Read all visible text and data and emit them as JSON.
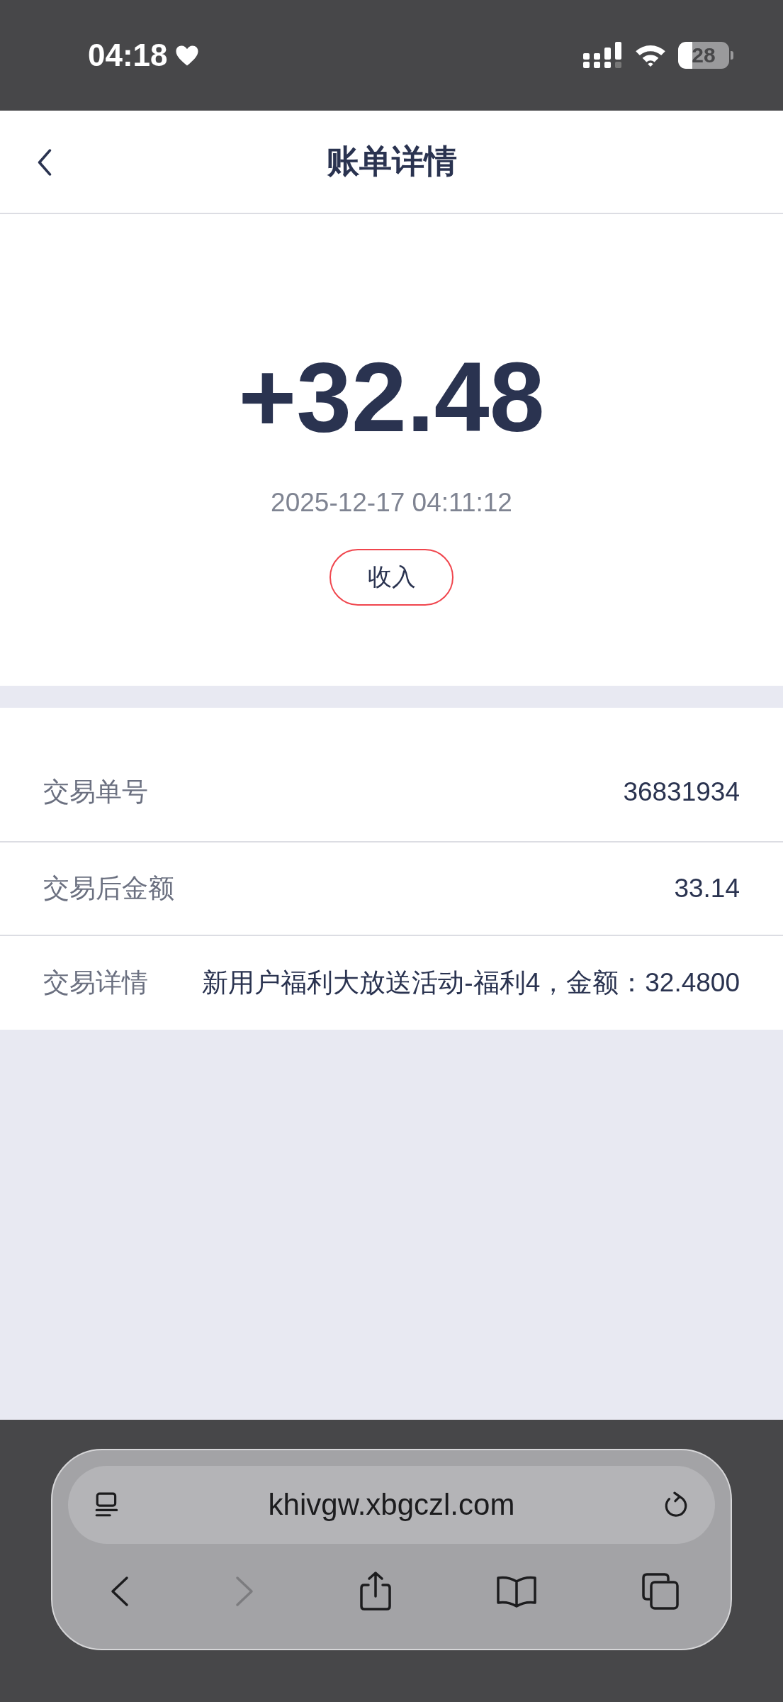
{
  "status_bar": {
    "time": "04:18",
    "battery": "28"
  },
  "header": {
    "title": "账单详情"
  },
  "summary": {
    "amount": "+32.48",
    "datetime": "2025-12-17 04:11:12",
    "tag": "收入"
  },
  "details": [
    {
      "label": "交易单号",
      "value": "36831934"
    },
    {
      "label": "交易后金额",
      "value": "33.14"
    },
    {
      "label": "交易详情",
      "value": "新用户福利大放送活动-福利4，金额：32.4800"
    }
  ],
  "browser": {
    "url": "khivgw.xbgczl.com",
    "toolbar": [
      {
        "kind": "back",
        "disabled": false
      },
      {
        "kind": "forward",
        "disabled": true
      },
      {
        "kind": "share",
        "disabled": false
      },
      {
        "kind": "bookmarks",
        "disabled": false
      },
      {
        "kind": "tabs",
        "disabled": false
      }
    ]
  }
}
